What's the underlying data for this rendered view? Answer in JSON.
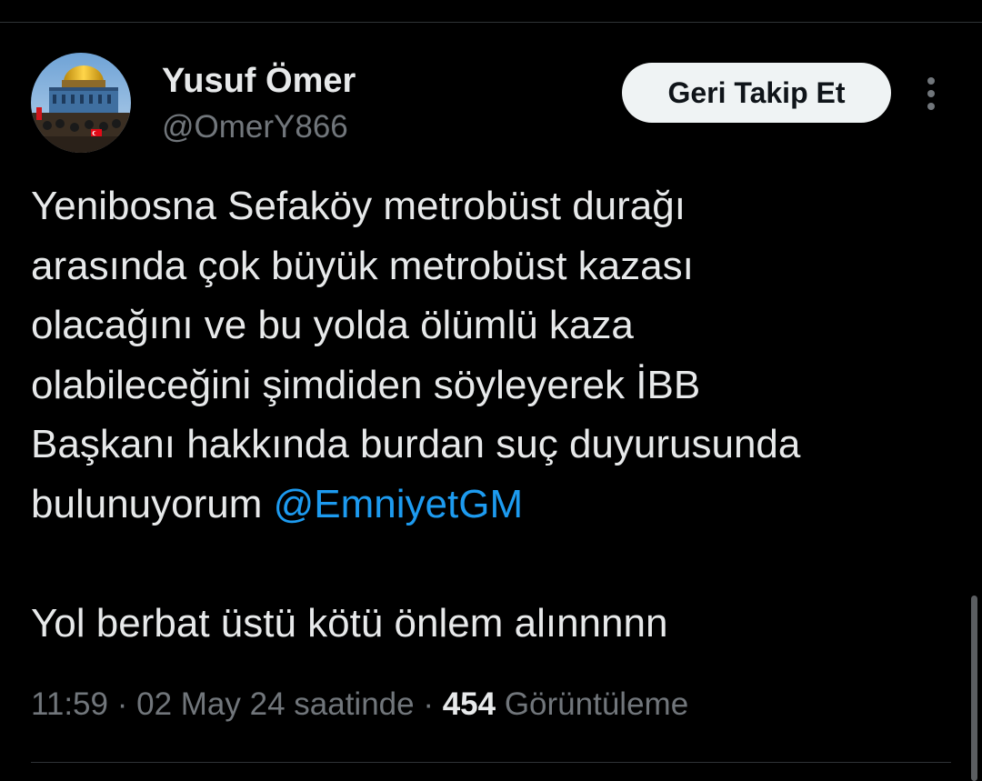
{
  "user": {
    "display_name": "Yusuf Ömer",
    "handle": "@OmerY866",
    "avatar_icon": "dome-of-the-rock-photo"
  },
  "actions": {
    "follow_label": "Geri Takip Et",
    "more_icon": "more-vertical-icon"
  },
  "tweet": {
    "text_before_mention": "Yenibosna Sefaköy metrobüst durağı\narasında çok büyük metrobüst kazası\nolacağını ve bu yolda ölümlü kaza\nolabileceğini şimdiden söyleyerek İBB\nBaşkanı hakkında burdan suç duyurusunda\nbulunuyorum ",
    "mention": "@EmniyetGM",
    "text_after_mention": "\n\nYol berbat üstü kötü önlem alınnnnn"
  },
  "meta": {
    "time": "11:59",
    "separator_1": " · ",
    "date": "02 May 24 saatinde",
    "separator_2": " · ",
    "views_count": "454",
    "views_label": " Görüntüleme"
  },
  "colors": {
    "background": "#000000",
    "text_primary": "#e7e9ea",
    "text_secondary": "#71767b",
    "link": "#1d9bf0",
    "button_bg": "#eff3f4",
    "divider": "#2f3336"
  }
}
